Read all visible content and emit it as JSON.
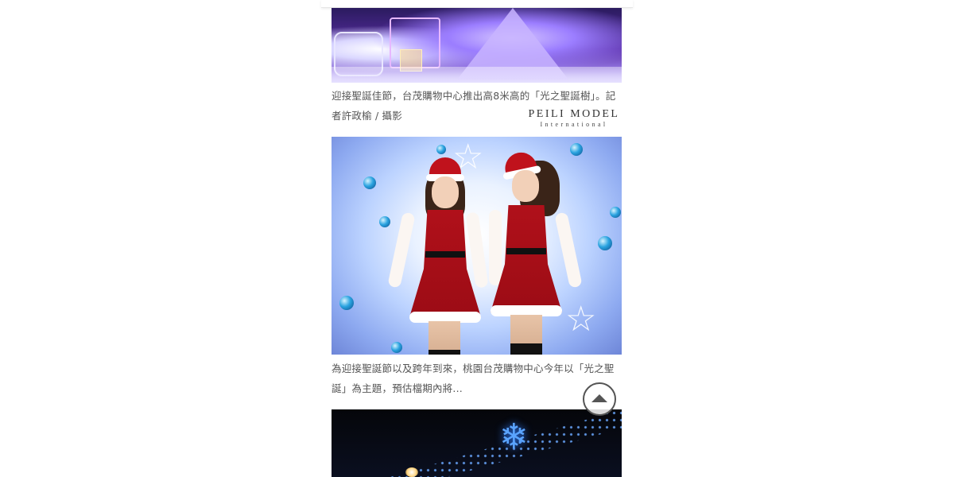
{
  "articles": [
    {
      "caption": "迎接聖誕佳節，台茂購物中心推出高8米高的「光之聖誕樹」。記者許政榆 / 攝影"
    },
    {
      "caption": "為迎接聖誕節以及跨年到來，桃園台茂購物中心今年以「光之聖誕」為主題，預估檔期內將..."
    }
  ],
  "watermark": {
    "main": "PEILI MODEL",
    "sub": "International"
  },
  "icons": {
    "back_to_top": "caret-up-circle-icon"
  },
  "colors": {
    "caption_text": "#555555",
    "button_border": "#555555"
  }
}
